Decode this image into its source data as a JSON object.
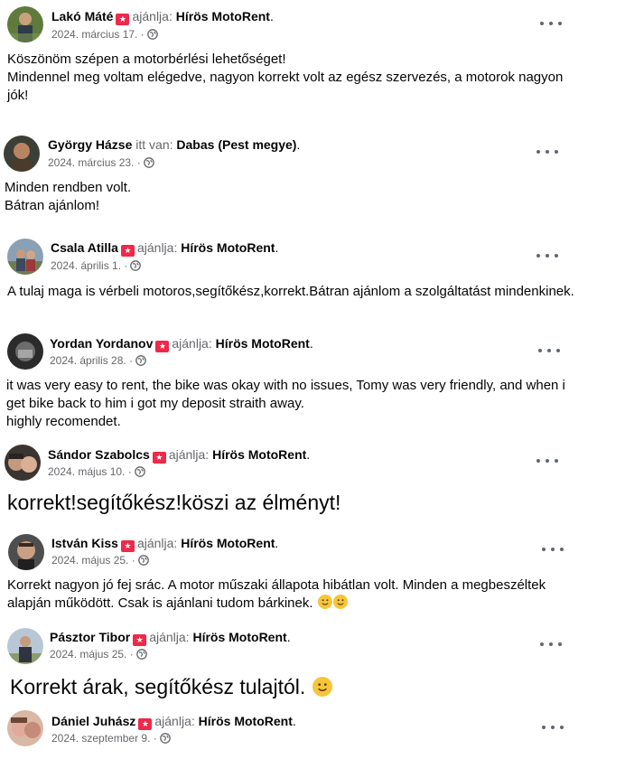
{
  "reviews": [
    {
      "name": "Lakó Máté",
      "action": "ajánlja:",
      "page": "Hírös MotoRent",
      "date": "2024. március 17.",
      "lines": [
        "Köszönöm szépen a motorbérlési lehetőséget!",
        "Mindennel meg voltam elégedve, nagyon korrekt volt az egész szervezés, a motorok nagyon jók!"
      ]
    },
    {
      "name": "György Házse",
      "action": "itt van:",
      "page": "Dabas (Pest megye)",
      "date": "2024. március 23.",
      "lines": [
        "Minden rendben volt.",
        "Bátran ajánlom!"
      ]
    },
    {
      "name": "Csala Atilla",
      "action": "ajánlja:",
      "page": "Hírös MotoRent",
      "date": "2024. április 1.",
      "lines": [
        "A tulaj maga is vérbeli motoros,segítőkész,korrekt.Bátran ajánlom a szolgáltatást mindenkinek."
      ]
    },
    {
      "name": "Yordan Yordanov",
      "action": "ajánlja:",
      "page": "Hírös MotoRent",
      "date": "2024. április 28.",
      "lines": [
        "it was very easy to rent, the bike was okay with no issues, Tomy was very friendly,  and when i get bike back to him i got my deposit straith away.",
        "highly recomendet."
      ]
    },
    {
      "name": "Sándor Szabolcs",
      "action": "ajánlja:",
      "page": "Hírös MotoRent",
      "date": "2024. május 10.",
      "lines": [
        "korrekt!segítőkész!köszi az élményt!"
      ]
    },
    {
      "name": "István Kiss",
      "action": "ajánlja:",
      "page": "Hírös MotoRent",
      "date": "2024. május 25.",
      "lines": [
        "Korrekt nagyon jó fej srác. A motor műszaki állapota hibátlan volt. Minden a megbeszéltek alapján működött. Csak is ajánlani tudom bárkinek."
      ]
    },
    {
      "name": "Pásztor Tibor",
      "action": "ajánlja:",
      "page": "Hírös MotoRent",
      "date": "2024. május 25.",
      "lines": [
        "Korrekt árak, segítőkész tulajtól."
      ]
    },
    {
      "name": "Dániel Juhász",
      "action": "ajánlja:",
      "page": "Hírös MotoRent",
      "date": "2024. szeptember 9.",
      "lines": []
    }
  ],
  "icons": {
    "recommend": "recommend-icon",
    "audience": "globe-icon",
    "more": "more-options-icon",
    "emoji": "smile-emoji-icon"
  },
  "colors": {
    "recommend": "#f02849",
    "meta": "#65676b",
    "text": "#050505"
  }
}
